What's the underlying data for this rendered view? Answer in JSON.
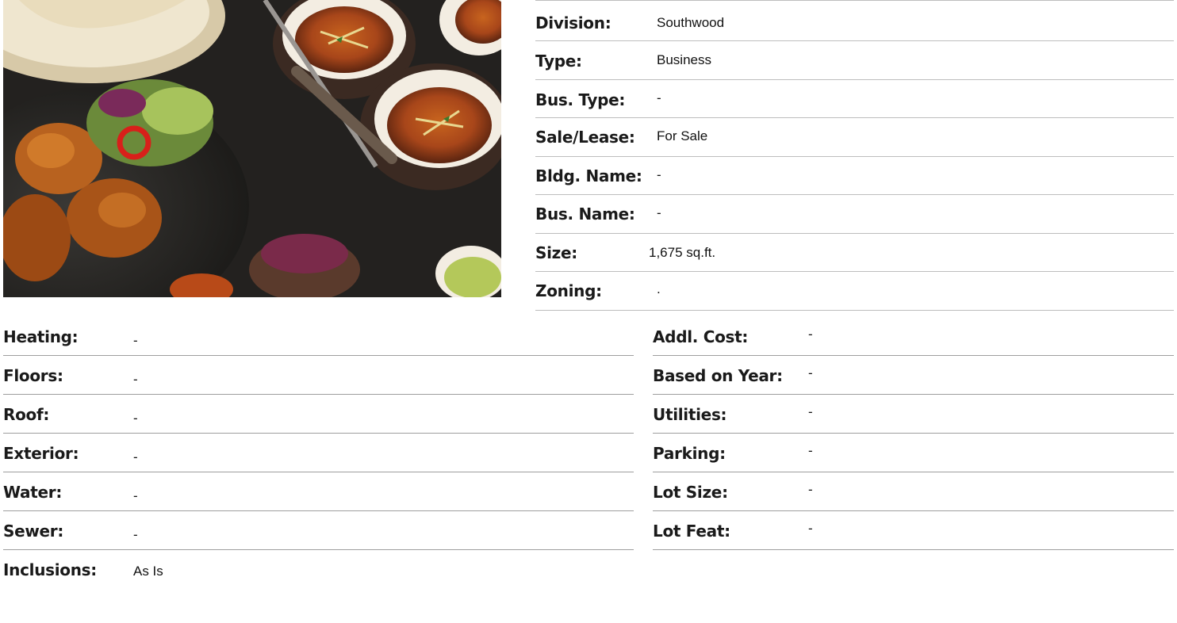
{
  "property": {
    "division": {
      "label": "Division:",
      "value": "Southwood"
    },
    "type": {
      "label": "Type:",
      "value": "Business"
    },
    "bus_type": {
      "label": "Bus. Type:",
      "value": "-"
    },
    "sale_lease": {
      "label": "Sale/Lease:",
      "value": "For Sale"
    },
    "bldg_name": {
      "label": "Bldg. Name:",
      "value": "-"
    },
    "bus_name": {
      "label": "Bus. Name:",
      "value": "-"
    },
    "size": {
      "label": "Size:",
      "value": "1,675 sq.ft."
    },
    "zoning": {
      "label": "Zoning:",
      "value": "."
    }
  },
  "features_left": [
    {
      "label": "Heating:",
      "value": "-"
    },
    {
      "label": "Floors:",
      "value": "-"
    },
    {
      "label": "Roof:",
      "value": "-"
    },
    {
      "label": "Exterior:",
      "value": "-"
    },
    {
      "label": "Water:",
      "value": "-"
    },
    {
      "label": "Sewer:",
      "value": "-"
    },
    {
      "label": "Inclusions:",
      "value": "As Is"
    }
  ],
  "features_right": [
    {
      "label": "Addl. Cost:",
      "value": "-"
    },
    {
      "label": "Based on Year:",
      "value": "-"
    },
    {
      "label": "Utilities:",
      "value": "-"
    },
    {
      "label": "Parking:",
      "value": "-"
    },
    {
      "label": "Lot Size:",
      "value": "-"
    },
    {
      "label": "Lot Feat:",
      "value": "-"
    }
  ]
}
